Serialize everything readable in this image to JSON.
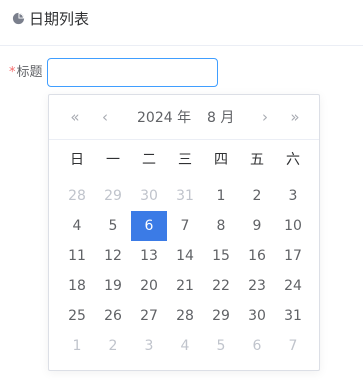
{
  "header": {
    "title": "日期列表",
    "icon": "pie-chart-icon"
  },
  "form": {
    "required_mark": "*",
    "label": "标题",
    "input_value": "",
    "input_placeholder": ""
  },
  "picker": {
    "nav": {
      "prev_year": "«",
      "prev_month": "‹",
      "next_month": "›",
      "next_year": "»"
    },
    "year_label": "2024 年",
    "month_label": "8 月",
    "weekdays": [
      "日",
      "一",
      "二",
      "三",
      "四",
      "五",
      "六"
    ],
    "weeks": [
      [
        {
          "d": "28",
          "other": true
        },
        {
          "d": "29",
          "other": true
        },
        {
          "d": "30",
          "other": true
        },
        {
          "d": "31",
          "other": true
        },
        {
          "d": "1"
        },
        {
          "d": "2"
        },
        {
          "d": "3"
        }
      ],
      [
        {
          "d": "4"
        },
        {
          "d": "5"
        },
        {
          "d": "6",
          "selected": true
        },
        {
          "d": "7"
        },
        {
          "d": "8"
        },
        {
          "d": "9"
        },
        {
          "d": "10"
        }
      ],
      [
        {
          "d": "11"
        },
        {
          "d": "12"
        },
        {
          "d": "13"
        },
        {
          "d": "14"
        },
        {
          "d": "15"
        },
        {
          "d": "16"
        },
        {
          "d": "17"
        }
      ],
      [
        {
          "d": "18"
        },
        {
          "d": "19"
        },
        {
          "d": "20"
        },
        {
          "d": "21"
        },
        {
          "d": "22"
        },
        {
          "d": "23"
        },
        {
          "d": "24"
        }
      ],
      [
        {
          "d": "25"
        },
        {
          "d": "26"
        },
        {
          "d": "27"
        },
        {
          "d": "28"
        },
        {
          "d": "29"
        },
        {
          "d": "30"
        },
        {
          "d": "31"
        }
      ],
      [
        {
          "d": "1",
          "other": true
        },
        {
          "d": "2",
          "other": true
        },
        {
          "d": "3",
          "other": true
        },
        {
          "d": "4",
          "other": true
        },
        {
          "d": "5",
          "other": true
        },
        {
          "d": "6",
          "other": true
        },
        {
          "d": "7",
          "other": true
        }
      ]
    ],
    "selected_color": "#3b7be6"
  }
}
